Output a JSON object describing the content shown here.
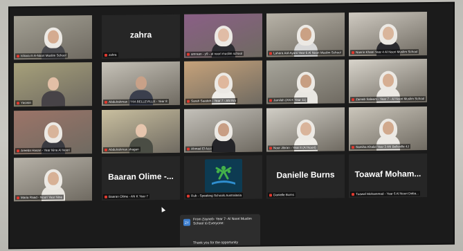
{
  "meeting": {
    "participants": [
      {
        "label": "Ishara m A-Noori Muslim School",
        "display_name": "",
        "video": true,
        "scarf": true,
        "bg": "#a29f93",
        "skin": "#d4ab90",
        "clothes": "#4a4a4e"
      },
      {
        "label": "zahra",
        "display_name": "zahra",
        "video": false
      },
      {
        "label": "amraan - y9 - al noori muslim school",
        "display_name": "",
        "video": true,
        "scarf": true,
        "bg": "#8a5f86",
        "skin": "#e0bca6",
        "clothes": "#2b2b30"
      },
      {
        "label": "Lahara Aal-Ayani Year 6 Al Noori Muslim School",
        "display_name": "",
        "video": true,
        "scarf": true,
        "bg": "#b8b3a8",
        "skin": "#caa184",
        "clothes": "#d8d8d8"
      },
      {
        "label": "Nasrin Khatri Year 4 Al Noori Muslim School",
        "display_name": "",
        "video": true,
        "scarf": true,
        "bg": "#cfcac1",
        "skin": "#d9b59b",
        "clothes": "#2a2a2e"
      },
      {
        "label": "Yasmin",
        "display_name": "",
        "video": true,
        "scarf": false,
        "bg": "#a6a07a",
        "skin": "#e2bfa6",
        "clothes": "#474347"
      },
      {
        "label": "Abdulrahman | Y4A BELLEVILLE - Year 8",
        "display_name": "",
        "video": true,
        "scarf": false,
        "bg": "#c6c2b8",
        "skin": "#c8a188",
        "clothes": "#3b3f4d"
      },
      {
        "label": "Sarah Saadeh - Year 7 - AN Rm",
        "display_name": "",
        "video": true,
        "scarf": true,
        "bg": "#c6a27a",
        "skin": "#dfb79c",
        "clothes": "#f0eee9"
      },
      {
        "label": "Jamilah (AN K Year 11)",
        "display_name": "",
        "video": true,
        "scarf": true,
        "bg": "#a7a59b",
        "skin": "#c79e82",
        "clothes": "#e9e7e2"
      },
      {
        "label": "Zainab Saleem - Year 7 - Al Noori Muslim School",
        "display_name": "",
        "video": true,
        "scarf": true,
        "bg": "#d8d4cb",
        "skin": "#d6ae92",
        "clothes": "#ece9e4"
      },
      {
        "label": "Areeba Hasan - Year Nine Al Noori",
        "display_name": "",
        "video": true,
        "scarf": true,
        "bg": "#9c7468",
        "skin": "#d8b49a",
        "clothes": "#3a3a40"
      },
      {
        "label": "Abdulrahman.shagan",
        "display_name": "",
        "video": true,
        "scarf": false,
        "bg": "#c9bf9f",
        "skin": "#e6c5ad",
        "clothes": "#4a4d44"
      },
      {
        "label": "Ahmad El Azzi",
        "display_name": "",
        "video": true,
        "scarf": true,
        "bg": "#c4c1ba",
        "skin": "#c89e84",
        "clothes": "#242428"
      },
      {
        "label": "Nour Jibran - Year 8 (Al Noori)",
        "display_name": "",
        "video": true,
        "scarf": true,
        "bg": "#d1cec6",
        "skin": "#d9b49b",
        "clothes": "#efede8"
      },
      {
        "label": "Samiha Khalid Year 3 AN Belleville 4J",
        "display_name": "",
        "video": true,
        "scarf": true,
        "bg": "#cbc6bb",
        "skin": "#d1a98d",
        "clothes": "#ebe8e3"
      },
      {
        "label": "Maria Raad - Noori Year Nine",
        "display_name": "",
        "video": true,
        "scarf": true,
        "bg": "#b7b2a8",
        "skin": "#d7b196",
        "clothes": "#e8e5df"
      },
      {
        "label": "Baaran Olime - AN K Year 7",
        "display_name": "Baaran Olime -...",
        "video": false
      },
      {
        "label": "Rub - Speaking Schools Australasia",
        "display_name": "",
        "video": false,
        "logo": true
      },
      {
        "label": "Danielle Burns",
        "display_name": "Danielle Burns",
        "video": false
      },
      {
        "label": "Tuawaf Mohammad - Year 6 Al Noori Deba...",
        "display_name": "Toawaf Moham...",
        "video": false
      }
    ]
  },
  "chat_popup": {
    "avatar_initials": "ZY",
    "from_text": "From Zayneb- Year 7- Al Noori Muslim School to Everyone:",
    "message": "Thank you for the opportunity"
  },
  "colors": {
    "screen_bg": "#1b1b1b",
    "tile_bg": "#262626",
    "mic_muted": "#e0392f",
    "chat_bg": "#2d2d2d",
    "logo_bg": "#0d3b52",
    "logo_green": "#43b049",
    "logo_blue": "#2f8fd0"
  }
}
